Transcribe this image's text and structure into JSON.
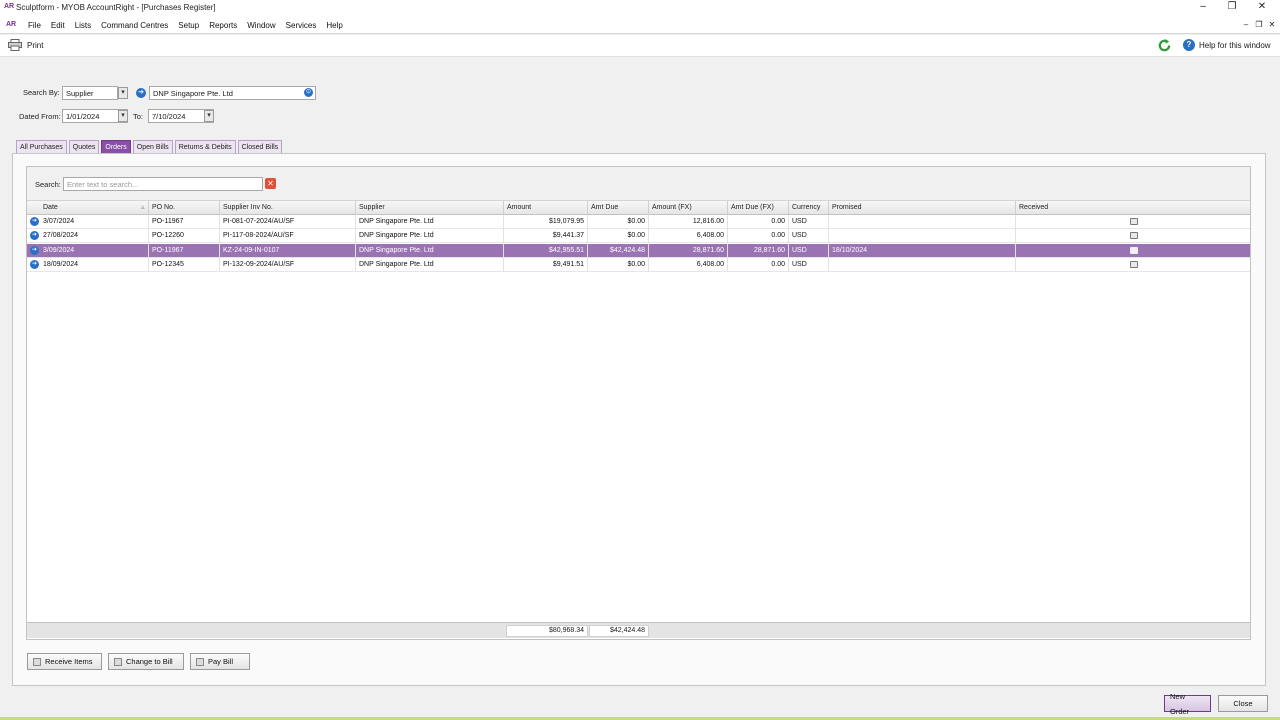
{
  "window": {
    "app_icon": "AR",
    "title": "Sculptform - MYOB AccountRight - [Purchases Register]",
    "controls": [
      "–",
      "❐",
      "✕"
    ]
  },
  "menubar": {
    "logo": "AR",
    "items": [
      "File",
      "Edit",
      "Lists",
      "Command Centres",
      "Setup",
      "Reports",
      "Window",
      "Services",
      "Help"
    ],
    "mdi_controls": [
      "–",
      "❐",
      "✕"
    ]
  },
  "toolbar": {
    "print_label": "Print",
    "help_label": "Help for this window"
  },
  "filters": {
    "search_by_label": "Search By:",
    "search_by_value": "Supplier",
    "supplier_value": "DNP Singapore Pte. Ltd",
    "dated_from_label": "Dated From:",
    "dated_from_value": "1/01/2024",
    "to_label": "To:",
    "to_value": "7/10/2024"
  },
  "tabs": [
    {
      "label": "All Purchases",
      "active": false
    },
    {
      "label": "Quotes",
      "active": false
    },
    {
      "label": "Orders",
      "active": true
    },
    {
      "label": "Open Bills",
      "active": false
    },
    {
      "label": "Returns & Debits",
      "active": false
    },
    {
      "label": "Closed Bills",
      "active": false
    }
  ],
  "search": {
    "label": "Search:",
    "placeholder": "Enter text to search..."
  },
  "table": {
    "columns": [
      "Date",
      "PO No.",
      "Supplier Inv No.",
      "Supplier",
      "Amount",
      "Amt Due",
      "Amount (FX)",
      "Amt Due (FX)",
      "Currency",
      "Promised",
      "Received"
    ],
    "sort_indicator": "▵",
    "rows": [
      {
        "date": "3/07/2024",
        "po": "PO-11967",
        "inv": "PI-081-07-2024/AU/SF",
        "supplier": "DNP Singapore Pte. Ltd",
        "amount": "$19,079.95",
        "amt_due": "$0.00",
        "amount_fx": "12,816.00",
        "amt_due_fx": "0.00",
        "currency": "USD",
        "promised": "",
        "selected": false
      },
      {
        "date": "27/08/2024",
        "po": "PO-12260",
        "inv": "PI-117-08-2024/AU/SF",
        "supplier": "DNP Singapore Pte. Ltd",
        "amount": "$9,441.37",
        "amt_due": "$0.00",
        "amount_fx": "6,408.00",
        "amt_due_fx": "0.00",
        "currency": "USD",
        "promised": "",
        "selected": false
      },
      {
        "date": "3/09/2024",
        "po": "PO-11967",
        "inv": "KZ-24-09-IN-0107",
        "supplier": "DNP Singapore Pte. Ltd",
        "amount": "$42,955.51",
        "amt_due": "$42,424.48",
        "amount_fx": "28,871.60",
        "amt_due_fx": "28,871.60",
        "currency": "USD",
        "promised": "18/10/2024",
        "selected": true
      },
      {
        "date": "18/09/2024",
        "po": "PO-12345",
        "inv": "PI-132-09-2024/AU/SF",
        "supplier": "DNP Singapore Pte. Ltd",
        "amount": "$9,491.51",
        "amt_due": "$0.00",
        "amount_fx": "6,408.00",
        "amt_due_fx": "0.00",
        "currency": "USD",
        "promised": "",
        "selected": false
      }
    ],
    "totals": {
      "amount": "$80,968.34",
      "amt_due": "$42,424.48"
    }
  },
  "actions": {
    "receive_items": "Receive Items",
    "change_to_bill": "Change to Bill",
    "pay_bill": "Pay Bill",
    "new_order": "New Order",
    "close": "Close"
  },
  "colors": {
    "accent": "#8a4fa6",
    "selected_row": "#9a73b2",
    "link_blue": "#2a6fc4"
  }
}
